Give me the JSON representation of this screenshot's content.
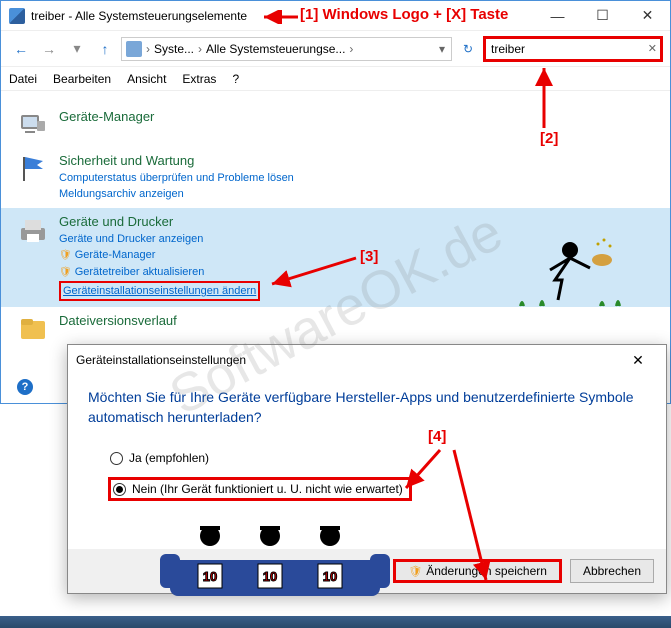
{
  "titlebar": {
    "text": "treiber - Alle Systemsteuerungselemente"
  },
  "breadcrumb": {
    "part1": "Syste...",
    "part2": "Alle Systemsteuerungse..."
  },
  "search": {
    "value": "treiber"
  },
  "menu": {
    "file": "Datei",
    "edit": "Bearbeiten",
    "view": "Ansicht",
    "extras": "Extras",
    "help": "?"
  },
  "cats": {
    "devmgr": {
      "title": "Geräte-Manager"
    },
    "security": {
      "title": "Sicherheit und Wartung",
      "link1": "Computerstatus überprüfen und Probleme lösen",
      "link2": "Meldungsarchiv anzeigen"
    },
    "devices": {
      "title": "Geräte und Drucker",
      "link1": "Geräte und Drucker anzeigen",
      "link2": "Geräte-Manager",
      "link3": "Gerätetreiber aktualisieren",
      "link4": "Geräteinstallationseinstellungen ändern"
    },
    "filehist": {
      "title": "Dateiversionsverlauf"
    }
  },
  "dialog": {
    "title": "Geräteinstallationseinstellungen",
    "heading": "Möchten Sie für Ihre Geräte verfügbare Hersteller-Apps und benutzerdefinierte Symbole automatisch herunterladen?",
    "opt_yes": "Ja (empfohlen)",
    "opt_no": "Nein (Ihr Gerät funktioniert u. U. nicht wie erwartet)",
    "btn_save": "Änderungen speichern",
    "btn_cancel": "Abbrechen"
  },
  "annot": {
    "a1": "[1] Windows Logo + [X] Taste",
    "a2": "[2]",
    "a3": "[3]",
    "a4": "[4]"
  },
  "watermark": "SoftwareOK.de"
}
